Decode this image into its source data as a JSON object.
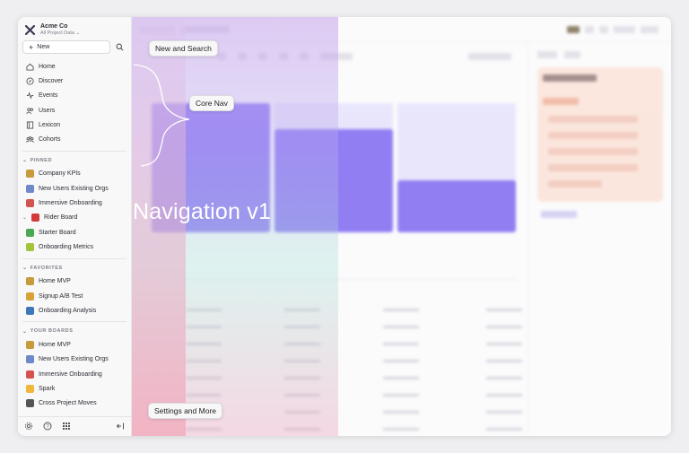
{
  "org": {
    "name": "Acme Co",
    "subtitle": "All Project Data"
  },
  "new_label": "New",
  "nav": [
    {
      "label": "Home",
      "icon": "home-icon"
    },
    {
      "label": "Discover",
      "icon": "compass-icon"
    },
    {
      "label": "Events",
      "icon": "events-icon"
    },
    {
      "label": "Users",
      "icon": "users-icon"
    },
    {
      "label": "Lexicon",
      "icon": "book-icon"
    },
    {
      "label": "Cohorts",
      "icon": "cohorts-icon"
    }
  ],
  "pinned": {
    "title": "PINNED",
    "items": [
      {
        "label": "Company KPIs",
        "color": "#c79a3b"
      },
      {
        "label": "New Users Existing Orgs",
        "color": "#6f88c9"
      },
      {
        "label": "Immersive Onboarding",
        "color": "#d4524f"
      },
      {
        "label": "Rider Board",
        "color": "#d23a3a"
      },
      {
        "label": "Starter Board",
        "color": "#4aa853"
      },
      {
        "label": "Onboarding Metrics",
        "color": "#a4c23a"
      }
    ]
  },
  "favorites": {
    "title": "FAVORITES",
    "items": [
      {
        "label": "Home MVP",
        "color": "#c79a3b"
      },
      {
        "label": "Signup A/B Test",
        "color": "#d7a238"
      },
      {
        "label": "Onboarding Analysis",
        "color": "#3c78b8"
      }
    ]
  },
  "your_boards": {
    "title": "YOUR BOARDS",
    "items": [
      {
        "label": "Home MVP",
        "color": "#c79a3b"
      },
      {
        "label": "New Users Existing Orgs",
        "color": "#6f88c9"
      },
      {
        "label": "Immersive Onboarding",
        "color": "#d4524f"
      },
      {
        "label": "Spark",
        "color": "#f0b73a"
      },
      {
        "label": "Cross Project Moves",
        "color": "#555"
      }
    ]
  },
  "callouts": {
    "new_and_search": "New and Search",
    "core_nav": "Core Nav",
    "settings": "Settings and More"
  },
  "headline": "Navigation v1",
  "bars": {
    "values": [
      100,
      80,
      40
    ],
    "ghost": [
      100,
      100,
      100
    ]
  }
}
